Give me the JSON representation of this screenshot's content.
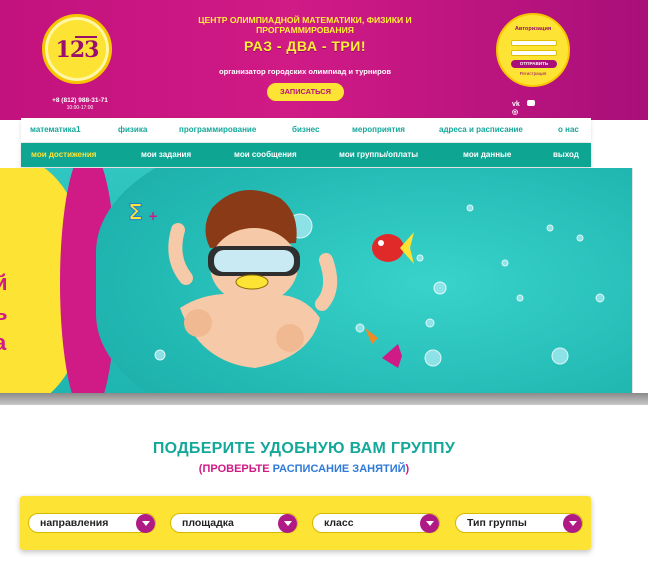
{
  "header": {
    "line1": "ЦЕНТР ОЛИМПИАДНОЙ МАТЕМАТИКИ, ФИЗИКИ И ПРОГРАММИРОВАНИЯ",
    "brand": "РАЗ - ДВА - ТРИ!",
    "tagline": "организатор городских олимпиад и турниров",
    "signup_label": "ЗАПИСАТЬСЯ",
    "phone": "+8 (812) 988-31-71",
    "hours": "10:00-17:00",
    "logo_text": "123"
  },
  "auth": {
    "title": "Авторизация",
    "submit_label": "ОТПРАВИТЬ",
    "register_label": "Регистрация"
  },
  "socials": [
    "vk-icon",
    "youtube-icon",
    "instagram-icon"
  ],
  "nav_primary": [
    {
      "label": "математика1"
    },
    {
      "label": "физика"
    },
    {
      "label": "программирование"
    },
    {
      "label": "бизнес"
    },
    {
      "label": "мероприятия"
    },
    {
      "label": "адреса и расписание"
    },
    {
      "label": "о нас"
    }
  ],
  "nav_secondary": [
    {
      "label": "мои достижения",
      "active": true
    },
    {
      "label": "мои задания"
    },
    {
      "label": "мои сообщения"
    },
    {
      "label": "мои группы/оплаты"
    },
    {
      "label": "мои данные"
    },
    {
      "label": "выход"
    }
  ],
  "section": {
    "title": "ПОДБЕРИТЕ УДОБНУЮ ВАМ ГРУППУ",
    "sub_open": "(",
    "sub_pink": "ПРОВЕРЬТЕ",
    "sub_blue": " РАСПИСАНИЕ ЗАНЯТИЙ",
    "sub_close": ")"
  },
  "filters": [
    {
      "label": "направления"
    },
    {
      "label": "площадка"
    },
    {
      "label": "класс"
    },
    {
      "label": "Тип группы"
    }
  ],
  "colors": {
    "header_magenta": "#c2127d",
    "accent_yellow": "#fde334",
    "teal": "#14a89a",
    "nav_teal": "#0fa593",
    "pink": "#d01a86",
    "blue": "#2f7ad8"
  }
}
